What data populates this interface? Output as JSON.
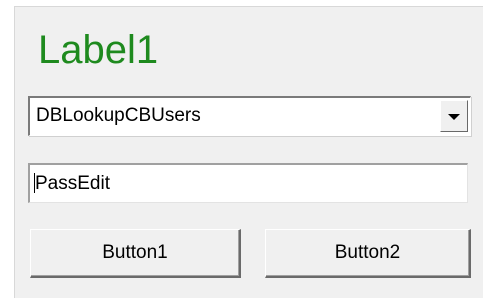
{
  "form": {
    "label": "Label1",
    "combo": {
      "value": "DBLookupCBUsers",
      "arrow_icon": "chevron-down-icon"
    },
    "edit": {
      "value": "PassEdit"
    },
    "buttons": [
      {
        "label": "Button1"
      },
      {
        "label": "Button2"
      }
    ],
    "colors": {
      "label": "#1e8a1e",
      "face": "#f0f0f0"
    }
  }
}
